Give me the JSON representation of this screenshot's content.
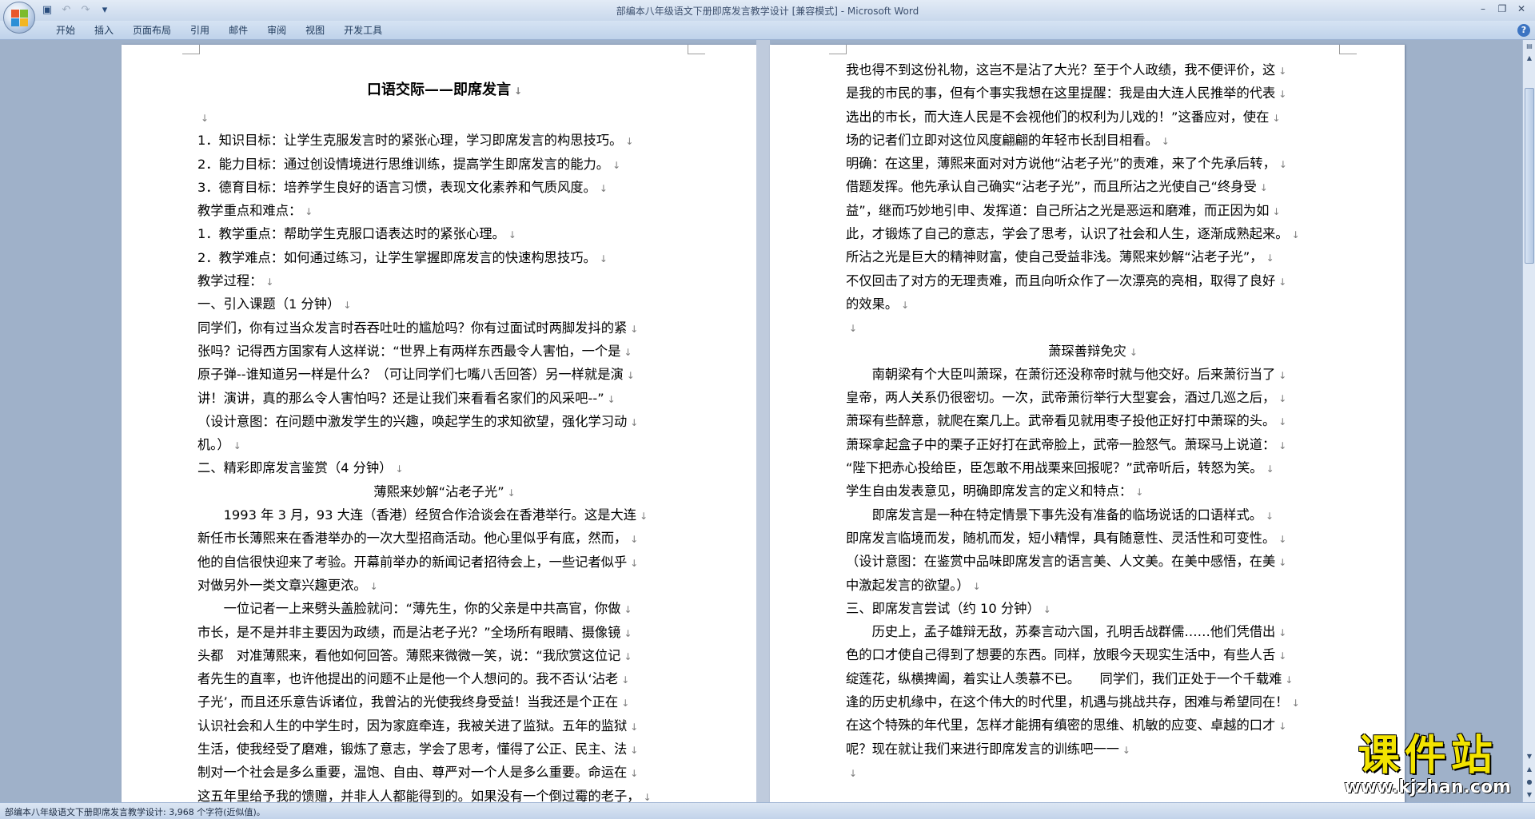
{
  "window": {
    "title": "部编本八年级语文下册即席发言教学设计 [兼容模式] - Microsoft Word"
  },
  "qat": {
    "save_icon": "save-icon",
    "undo_icon": "undo-icon",
    "redo_icon": "redo-icon",
    "customize_icon": "dropdown-icon"
  },
  "ribbon": {
    "tabs": [
      "开始",
      "插入",
      "页面布局",
      "引用",
      "邮件",
      "审阅",
      "视图",
      "开发工具"
    ]
  },
  "document": {
    "left_page": [
      {
        "text": "口语交际——即席发言",
        "style": "title"
      },
      {
        "text": "",
        "style": "normal"
      },
      {
        "text": "1．知识目标：让学生克服发言时的紧张心理，学习即席发言的构思技巧。",
        "style": "normal"
      },
      {
        "text": "2．能力目标：通过创设情境进行思维训练，提高学生即席发言的能力。",
        "style": "normal"
      },
      {
        "text": "3．德育目标：培养学生良好的语言习惯，表现文化素养和气质风度。",
        "style": "normal"
      },
      {
        "text": "教学重点和难点：",
        "style": "normal"
      },
      {
        "text": "1．教学重点：帮助学生克服口语表达时的紧张心理。",
        "style": "normal"
      },
      {
        "text": "2．教学难点：如何通过练习，让学生掌握即席发言的快速构思技巧。",
        "style": "normal"
      },
      {
        "text": "教学过程：",
        "style": "normal"
      },
      {
        "text": "一、引入课题（1 分钟）",
        "style": "normal"
      },
      {
        "text": "同学们，你有过当众发言时吞吞吐吐的尴尬吗？你有过面试时两脚发抖的紧",
        "style": "normal"
      },
      {
        "text": "张吗？记得西方国家有人这样说：“世界上有两样东西最令人害怕，一个是",
        "style": "normal"
      },
      {
        "text": "原子弹--谁知道另一样是什么？（可让同学们七嘴八舌回答）另一样就是演",
        "style": "normal"
      },
      {
        "text": "讲！演讲，真的那么令人害怕吗？还是让我们来看看名家们的风采吧--”",
        "style": "normal"
      },
      {
        "text": "（设计意图：在问题中激发学生的兴趣，唤起学生的求知欲望，强化学习动",
        "style": "normal"
      },
      {
        "text": "机。）",
        "style": "normal"
      },
      {
        "text": "二、精彩即席发言鉴赏（4 分钟）",
        "style": "normal"
      },
      {
        "text": "薄熙来妙解“沾老子光”",
        "style": "center"
      },
      {
        "text": "　　1993 年 3 月，93 大连（香港）经贸合作洽谈会在香港举行。这是大连",
        "style": "normal"
      },
      {
        "text": "新任市长薄熙来在香港举办的一次大型招商活动。他心里似乎有底，然而，",
        "style": "normal"
      },
      {
        "text": "他的自信很快迎来了考验。开幕前举办的新闻记者招待会上，一些记者似乎",
        "style": "normal"
      },
      {
        "text": "对做另外一类文章兴趣更浓。",
        "style": "normal"
      },
      {
        "text": "　　一位记者一上来劈头盖脸就问：“薄先生，你的父亲是中共高官，你做",
        "style": "normal"
      },
      {
        "text": "市长，是不是并非主要因为政绩，而是沾老子光？”全场所有眼睛、摄像镜",
        "style": "normal"
      },
      {
        "text": "头都　对准薄熙来，看他如何回答。薄熙来微微一笑，说：“我欣赏这位记",
        "style": "normal"
      },
      {
        "text": "者先生的直率，也许他提出的问题不止是他一个人想问的。我不否认‘沾老",
        "style": "normal"
      },
      {
        "text": "子光’，而且还乐意告诉诸位，我曾沾的光使我终身受益！当我还是个正在",
        "style": "normal"
      },
      {
        "text": "认识社会和人生的中学生时，因为家庭牵连，我被关进了监狱。五年的监狱",
        "style": "normal"
      },
      {
        "text": "生活，使我经受了磨难，锻炼了意志，学会了思考，懂得了公正、民主、法",
        "style": "normal"
      },
      {
        "text": "制对一个社会是多么重要，温饱、自由、尊严对一个人是多么重要。命运在",
        "style": "normal"
      },
      {
        "text": "这五年里给予我的馈赠，并非人人都能得到的。如果没有一个倒过霉的老子，",
        "style": "normal"
      }
    ],
    "right_page": [
      {
        "text": "我也得不到这份礼物，这岂不是沾了大光？至于个人政绩，我不便评价，这",
        "style": "normal"
      },
      {
        "text": "是我的市民的事，但有个事实我想在这里提醒：我是由大连人民推举的代表",
        "style": "normal"
      },
      {
        "text": "选出的市长，而大连人民是不会视他们的权利为儿戏的！”这番应对，使在",
        "style": "normal"
      },
      {
        "text": "场的记者们立即对这位风度翩翩的年轻市长刮目相看。",
        "style": "normal"
      },
      {
        "text": "明确：在这里，薄熙来面对对方说他“沾老子光”的责难，来了个先承后转，",
        "style": "normal"
      },
      {
        "text": "借题发挥。他先承认自己确实“沾老子光”，而且所沾之光使自己“终身受",
        "style": "normal"
      },
      {
        "text": "益”，继而巧妙地引申、发挥道：自己所沾之光是恶运和磨难，而正因为如",
        "style": "normal"
      },
      {
        "text": "此，才锻炼了自己的意志，学会了思考，认识了社会和人生，逐渐成熟起来。",
        "style": "normal"
      },
      {
        "text": "所沾之光是巨大的精神财富，使自己受益非浅。薄熙来妙解“沾老子光”，",
        "style": "normal"
      },
      {
        "text": "不仅回击了对方的无理责难，而且向听众作了一次漂亮的亮相，取得了良好",
        "style": "normal"
      },
      {
        "text": "的效果。",
        "style": "normal"
      },
      {
        "text": "",
        "style": "normal"
      },
      {
        "text": "萧琛善辩免灾",
        "style": "center"
      },
      {
        "text": "　　南朝梁有个大臣叫萧琛，在萧衍还没称帝时就与他交好。后来萧衍当了",
        "style": "normal"
      },
      {
        "text": "皇帝，两人关系仍很密切。一次，武帝萧衍举行大型宴会，酒过几巡之后，",
        "style": "normal"
      },
      {
        "text": "萧琛有些醉意，就爬在案几上。武帝看见就用枣子投他正好打中萧琛的头。",
        "style": "normal"
      },
      {
        "text": "萧琛拿起盒子中的栗子正好打在武帝脸上，武帝一脸怒气。萧琛马上说道：",
        "style": "normal"
      },
      {
        "text": "“陛下把赤心投给臣，臣怎敢不用战栗来回报呢？”武帝听后，转怒为笑。",
        "style": "normal"
      },
      {
        "text": "学生自由发表意见，明确即席发言的定义和特点：",
        "style": "normal"
      },
      {
        "text": "　　即席发言是一种在特定情景下事先没有准备的临场说话的口语样式。",
        "style": "normal"
      },
      {
        "text": "即席发言临境而发，随机而发，短小精悍，具有随意性、灵活性和可变性。",
        "style": "normal"
      },
      {
        "text": "（设计意图：在鉴赏中品味即席发言的语言美、人文美。在美中感悟，在美",
        "style": "normal"
      },
      {
        "text": "中激起发言的欲望。）",
        "style": "normal"
      },
      {
        "text": "三、即席发言尝试（约 10 分钟）",
        "style": "normal"
      },
      {
        "text": "　　历史上，孟子雄辩无敌，苏秦言动六国，孔明舌战群儒……他们凭借出",
        "style": "normal"
      },
      {
        "text": "色的口才使自己得到了想要的东西。同样，放眼今天现实生活中，有些人舌",
        "style": "normal"
      },
      {
        "text": "绽莲花，纵横捭阖，着实让人羡慕不已。　　同学们，我们正处于一个千载难",
        "style": "normal"
      },
      {
        "text": "逢的历史机缘中，在这个伟大的时代里，机遇与挑战共存，困难与希望同在！",
        "style": "normal"
      },
      {
        "text": "在这个特殊的年代里，怎样才能拥有缜密的思维、机敏的应变、卓越的口才",
        "style": "normal"
      },
      {
        "text": "呢？现在就让我们来进行即席发言的训练吧一一",
        "style": "normal"
      },
      {
        "text": "",
        "style": "normal"
      }
    ]
  },
  "paragraph_mark": "↓",
  "status": {
    "text": "部编本八年级语文下册即席发言教学设计: 3,968 个字符(近似值)。"
  },
  "watermark": {
    "title": "课件站",
    "url": "www.kjzhan.com"
  },
  "colors": {
    "workspace": "#9fb1c9",
    "ribbon": "#bfd2ea",
    "watermark_yellow": "#f2e300"
  }
}
